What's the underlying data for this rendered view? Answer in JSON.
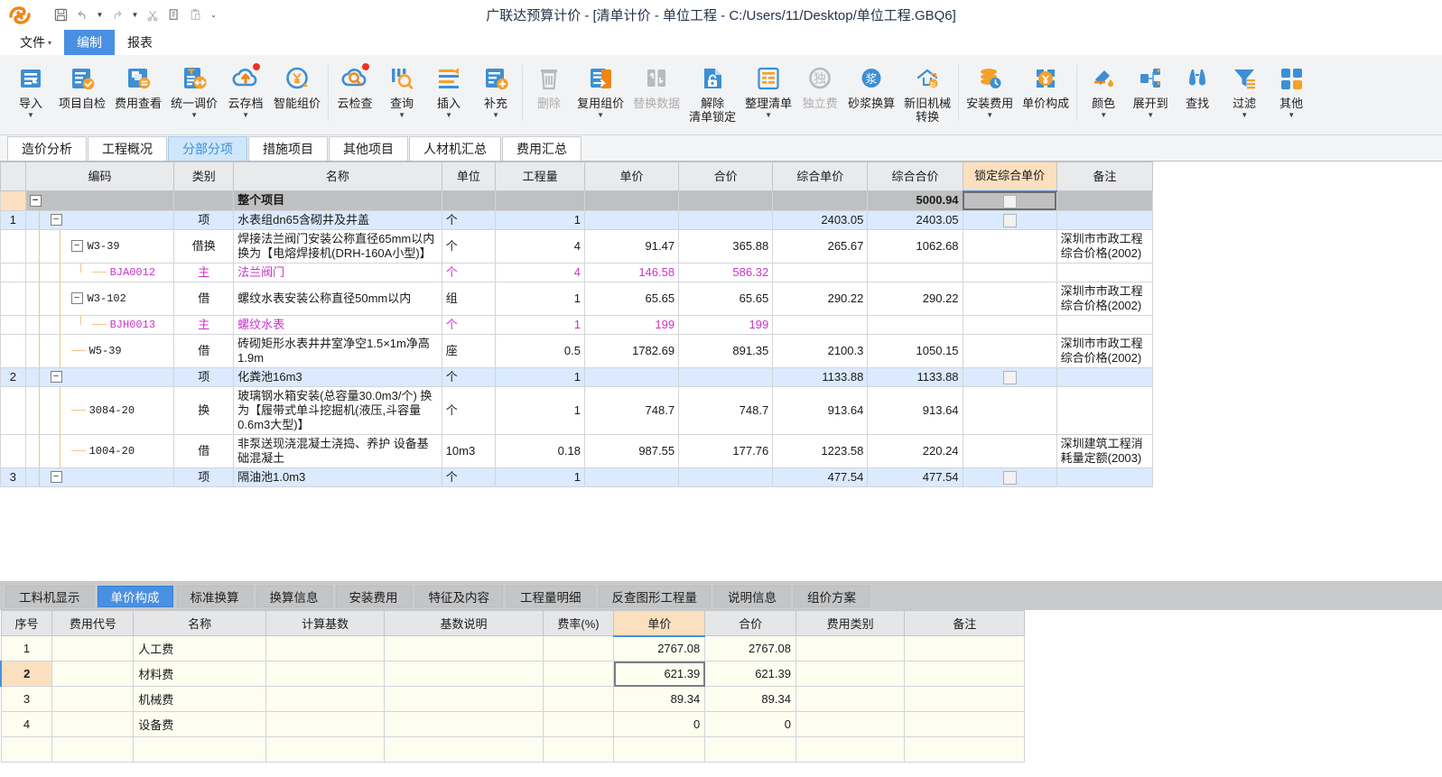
{
  "titlebar": {
    "app_title": "广联达预算计价 - [清单计价 - 单位工程 - C:/Users/11/Desktop/单位工程.GBQ6]",
    "quick_access": [
      {
        "name": "save-icon",
        "glyph": "🖫"
      },
      {
        "name": "undo-icon",
        "glyph": "↶"
      },
      {
        "name": "undo-dropdown-icon",
        "glyph": "▾"
      },
      {
        "name": "redo-icon",
        "glyph": "↷"
      },
      {
        "name": "redo-dropdown-icon",
        "glyph": "▾"
      },
      {
        "name": "cut-icon",
        "glyph": "✂"
      },
      {
        "name": "copy-icon",
        "glyph": "⎘"
      },
      {
        "name": "paste-icon",
        "glyph": "⎗"
      },
      {
        "name": "qat-more-icon",
        "glyph": "⌄"
      }
    ]
  },
  "menubar": {
    "items": [
      {
        "label": "文件",
        "caret": "▾",
        "active": false
      },
      {
        "label": "编制",
        "caret": "",
        "active": true
      },
      {
        "label": "报表",
        "caret": "",
        "active": false
      }
    ]
  },
  "ribbon": {
    "buttons": [
      {
        "label": "导入",
        "icon": "import-icon",
        "dropdown": true,
        "disabled": false
      },
      {
        "label": "项目自检",
        "icon": "project-selfcheck-icon",
        "dropdown": false,
        "disabled": false
      },
      {
        "label": "费用查看",
        "icon": "fee-view-icon",
        "dropdown": false,
        "disabled": false
      },
      {
        "label": "统一调价",
        "icon": "unified-price-adjust-icon",
        "dropdown": true,
        "disabled": false
      },
      {
        "label": "云存档",
        "icon": "cloud-archive-icon",
        "dropdown": true,
        "disabled": false,
        "badge": true
      },
      {
        "label": "智能组价",
        "icon": "smart-pricing-icon",
        "dropdown": false,
        "disabled": false
      },
      {
        "label": "云检查",
        "icon": "cloud-check-icon",
        "dropdown": false,
        "disabled": false,
        "badge": true
      },
      {
        "label": "查询",
        "icon": "query-icon",
        "dropdown": true,
        "disabled": false
      },
      {
        "label": "插入",
        "icon": "insert-icon",
        "dropdown": true,
        "disabled": false
      },
      {
        "label": "补充",
        "icon": "supplement-icon",
        "dropdown": true,
        "disabled": false
      },
      {
        "label": "删除",
        "icon": "delete-icon",
        "dropdown": false,
        "disabled": true
      },
      {
        "label": "复用组价",
        "icon": "reuse-pricing-icon",
        "dropdown": true,
        "disabled": false
      },
      {
        "label": "替换数据",
        "icon": "replace-data-icon",
        "dropdown": false,
        "disabled": true
      },
      {
        "label": "解除\n清单锁定",
        "icon": "unlock-list-icon",
        "dropdown": false,
        "disabled": false
      },
      {
        "label": "整理清单",
        "icon": "organize-list-icon",
        "dropdown": true,
        "disabled": false
      },
      {
        "label": "独立费",
        "icon": "independent-fee-icon",
        "dropdown": false,
        "disabled": true
      },
      {
        "label": "砂浆换算",
        "icon": "mortar-conversion-icon",
        "dropdown": false,
        "disabled": false
      },
      {
        "label": "新旧机械\n转换",
        "icon": "machine-conversion-icon",
        "dropdown": false,
        "disabled": false
      },
      {
        "label": "安装费用",
        "icon": "installation-fee-icon",
        "dropdown": true,
        "disabled": false
      },
      {
        "label": "单价构成",
        "icon": "unit-price-composition-icon",
        "dropdown": false,
        "disabled": false
      },
      {
        "label": "颜色",
        "icon": "color-icon",
        "dropdown": true,
        "disabled": false
      },
      {
        "label": "展开到",
        "icon": "expand-to-icon",
        "dropdown": true,
        "disabled": false
      },
      {
        "label": "查找",
        "icon": "find-icon",
        "dropdown": false,
        "disabled": false
      },
      {
        "label": "过滤",
        "icon": "filter-icon",
        "dropdown": true,
        "disabled": false
      },
      {
        "label": "其他",
        "icon": "other-icon",
        "dropdown": true,
        "disabled": false
      }
    ]
  },
  "main_tabs": [
    {
      "label": "造价分析",
      "active": false
    },
    {
      "label": "工程概况",
      "active": false
    },
    {
      "label": "分部分项",
      "active": true
    },
    {
      "label": "措施项目",
      "active": false
    },
    {
      "label": "其他项目",
      "active": false
    },
    {
      "label": "人材机汇总",
      "active": false
    },
    {
      "label": "费用汇总",
      "active": false
    }
  ],
  "grid": {
    "headers": [
      "",
      "编码",
      "类别",
      "名称",
      "单位",
      "工程量",
      "单价",
      "合价",
      "综合单价",
      "综合合价",
      "锁定综合单价",
      "备注"
    ],
    "rows": [
      {
        "type": "total",
        "rowno": "",
        "code": "",
        "category": "",
        "name": "整个项目",
        "unit": "",
        "qty": "",
        "price": "",
        "amount": "",
        "comp_price": "",
        "comp_amount": "5000.94",
        "lock": "checkbox-active",
        "note": "",
        "indent": 0,
        "expander": "−"
      },
      {
        "type": "item",
        "rowno": "1",
        "code": "",
        "category": "项",
        "name": "水表组dn65含砌井及井盖",
        "unit": "个",
        "qty": "1",
        "price": "",
        "amount": "",
        "comp_price": "2403.05",
        "comp_amount": "2403.05",
        "lock": "checkbox",
        "note": "",
        "indent": 1,
        "expander": "−"
      },
      {
        "type": "normal",
        "rowno": "",
        "code": "W3-39",
        "category": "借换",
        "name": "焊接法兰阀门安装公称直径65mm以内    换为【电熔焊接机(DRH-160A小型)】",
        "unit": "个",
        "qty": "4",
        "price": "91.47",
        "amount": "365.88",
        "comp_price": "265.67",
        "comp_amount": "1062.68",
        "lock": "",
        "note": "深圳市市政工程综合价格(2002)",
        "indent": 2,
        "expander": "−"
      },
      {
        "type": "material",
        "rowno": "",
        "code": "BJA0012",
        "category": "主",
        "name": "法兰阀门",
        "unit": "个",
        "qty": "4",
        "price": "146.58",
        "amount": "586.32",
        "comp_price": "",
        "comp_amount": "",
        "lock": "",
        "note": "",
        "indent": 3,
        "expander": ""
      },
      {
        "type": "normal",
        "rowno": "",
        "code": "W3-102",
        "category": "借",
        "name": "螺纹水表安装公称直径50mm以内",
        "unit": "组",
        "qty": "1",
        "price": "65.65",
        "amount": "65.65",
        "comp_price": "290.22",
        "comp_amount": "290.22",
        "lock": "",
        "note": "深圳市市政工程综合价格(2002)",
        "indent": 2,
        "expander": "−"
      },
      {
        "type": "material",
        "rowno": "",
        "code": "BJH0013",
        "category": "主",
        "name": "螺纹水表",
        "unit": "个",
        "qty": "1",
        "price": "199",
        "amount": "199",
        "comp_price": "",
        "comp_amount": "",
        "lock": "",
        "note": "",
        "indent": 3,
        "expander": ""
      },
      {
        "type": "normal",
        "rowno": "",
        "code": "W5-39",
        "category": "借",
        "name": "砖砌矩形水表井井室净空1.5×1m净高1.9m",
        "unit": "座",
        "qty": "0.5",
        "price": "1782.69",
        "amount": "891.35",
        "comp_price": "2100.3",
        "comp_amount": "1050.15",
        "lock": "",
        "note": "深圳市市政工程综合价格(2002)",
        "indent": 2,
        "expander": ""
      },
      {
        "type": "item",
        "rowno": "2",
        "code": "",
        "category": "项",
        "name": "化粪池16m3",
        "unit": "个",
        "qty": "1",
        "price": "",
        "amount": "",
        "comp_price": "1133.88",
        "comp_amount": "1133.88",
        "lock": "checkbox",
        "note": "",
        "indent": 1,
        "expander": "−"
      },
      {
        "type": "normal",
        "rowno": "",
        "code": "3084-20",
        "category": "换",
        "name": "玻璃钢水箱安装(总容量30.0m3/个)   换为【履带式单斗挖掘机(液压,斗容量0.6m3大型)】",
        "unit": "个",
        "qty": "1",
        "price": "748.7",
        "amount": "748.7",
        "comp_price": "913.64",
        "comp_amount": "913.64",
        "lock": "",
        "note": "",
        "indent": 2,
        "expander": ""
      },
      {
        "type": "normal",
        "rowno": "",
        "code": "1004-20",
        "category": "借",
        "name": "非泵送现浇混凝土浇捣、养护 设备基础混凝土",
        "unit": "10m3",
        "qty": "0.18",
        "price": "987.55",
        "amount": "177.76",
        "comp_price": "1223.58",
        "comp_amount": "220.24",
        "lock": "",
        "note": "深圳建筑工程消耗量定额(2003)",
        "indent": 2,
        "expander": ""
      },
      {
        "type": "item",
        "rowno": "3",
        "code": "",
        "category": "项",
        "name": "隔油池1.0m3",
        "unit": "个",
        "qty": "1",
        "price": "",
        "amount": "",
        "comp_price": "477.54",
        "comp_amount": "477.54",
        "lock": "checkbox",
        "note": "",
        "indent": 1,
        "expander": "−"
      }
    ]
  },
  "bottom_tabs": [
    {
      "label": "工料机显示",
      "active": false
    },
    {
      "label": "单价构成",
      "active": true
    },
    {
      "label": "标准换算",
      "active": false
    },
    {
      "label": "换算信息",
      "active": false
    },
    {
      "label": "安装费用",
      "active": false
    },
    {
      "label": "特征及内容",
      "active": false
    },
    {
      "label": "工程量明细",
      "active": false
    },
    {
      "label": "反查图形工程量",
      "active": false
    },
    {
      "label": "说明信息",
      "active": false
    },
    {
      "label": "组价方案",
      "active": false
    }
  ],
  "bottom_grid": {
    "headers": [
      "序号",
      "费用代号",
      "名称",
      "计算基数",
      "基数说明",
      "费率(%)",
      "单价",
      "合价",
      "费用类别",
      "备注"
    ],
    "rows": [
      {
        "no": "1",
        "code": "",
        "name": "人工费",
        "base": "",
        "base_desc": "",
        "rate": "",
        "price": "2767.08",
        "amount": "2767.08",
        "fee_type": "",
        "note": "",
        "active": false
      },
      {
        "no": "2",
        "code": "",
        "name": "材料费",
        "base": "",
        "base_desc": "",
        "rate": "",
        "price": "621.39",
        "amount": "621.39",
        "fee_type": "",
        "note": "",
        "active": true
      },
      {
        "no": "3",
        "code": "",
        "name": "机械费",
        "base": "",
        "base_desc": "",
        "rate": "",
        "price": "89.34",
        "amount": "89.34",
        "fee_type": "",
        "note": "",
        "active": false
      },
      {
        "no": "4",
        "code": "",
        "name": "设备费",
        "base": "",
        "base_desc": "",
        "rate": "",
        "price": "0",
        "amount": "0",
        "fee_type": "",
        "note": "",
        "active": false
      },
      {
        "no": "",
        "code": "",
        "name": "",
        "base": "",
        "base_desc": "",
        "rate": "",
        "price": "",
        "amount": "",
        "fee_type": "",
        "note": "",
        "active": false
      }
    ]
  },
  "colors": {
    "accent_blue": "#4a90e2",
    "orange": "#f59a23",
    "magenta": "#cc33cc",
    "lock_header": "#fbe0c0",
    "selected_row": "#dbeafe",
    "total_row": "#bfc0c2"
  }
}
